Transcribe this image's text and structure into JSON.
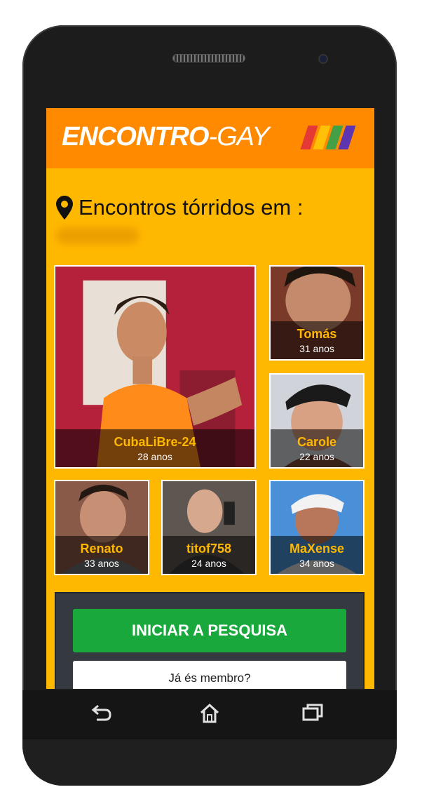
{
  "brand": {
    "part1": "ENCONTRO",
    "part2": "-GAY",
    "rainbow_colors": [
      "#e53935",
      "#FFC107",
      "#43A047",
      "#5E35B1"
    ]
  },
  "headline": "Encontros tórridos em :",
  "profiles": [
    {
      "name": "CubaLiBre-24",
      "age": "28 anos"
    },
    {
      "name": "Tomás",
      "age": "31 anos"
    },
    {
      "name": "Carole",
      "age": "22 anos"
    },
    {
      "name": "Renato",
      "age": "33 anos"
    },
    {
      "name": "titof758",
      "age": "24 anos"
    },
    {
      "name": "MaXense",
      "age": "34 anos"
    }
  ],
  "actions": {
    "search_label": "INICIAR A PESQUISA",
    "member_label": "Já és membro?"
  },
  "colors": {
    "screen_bg": "#FFB800",
    "header_bg": "#FF8A00",
    "accent_green": "#18A83C",
    "name_gold": "#FFB800"
  },
  "navbar": {
    "back_icon": "back-icon",
    "home_icon": "home-icon",
    "recents_icon": "recents-icon"
  }
}
